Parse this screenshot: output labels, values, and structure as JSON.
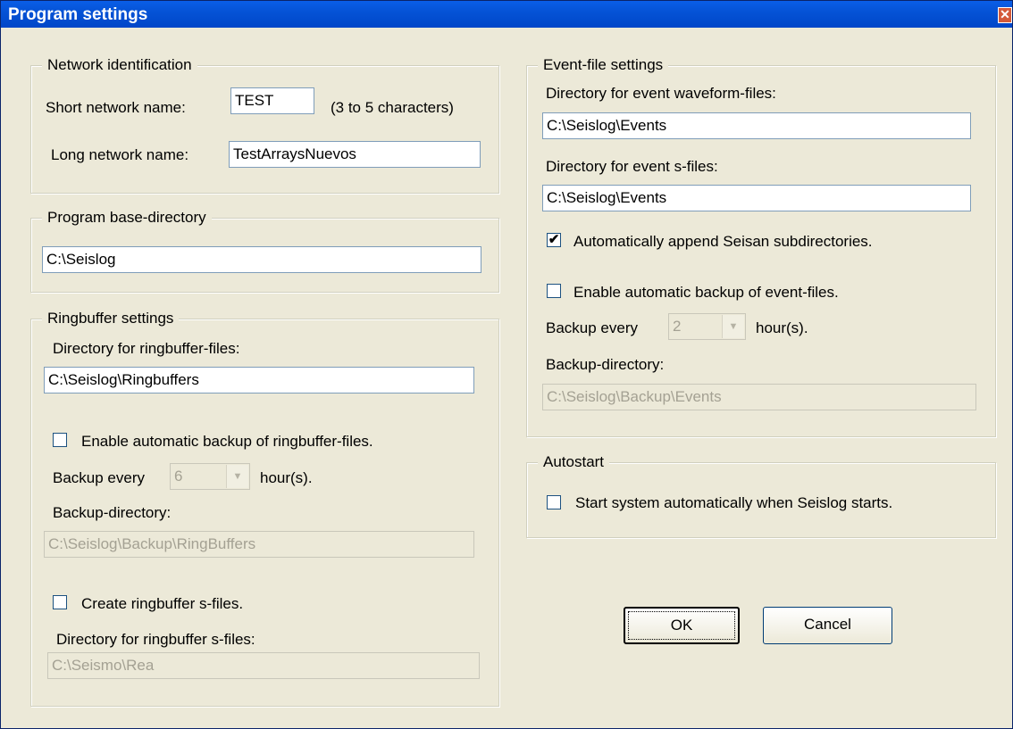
{
  "window": {
    "title": "Program settings"
  },
  "network": {
    "legend": "Network identification",
    "short_label": "Short network name:",
    "short_value": "TEST",
    "short_hint": "(3 to 5 characters)",
    "long_label": "Long network name:",
    "long_value": "TestArraysNuevos"
  },
  "base_dir": {
    "legend": "Program base-directory",
    "value": "C:\\Seislog"
  },
  "ringbuffer": {
    "legend": "Ringbuffer settings",
    "dir_label": "Directory for ringbuffer-files:",
    "dir_value": "C:\\Seislog\\Ringbuffers",
    "backup_enable_label": "Enable automatic backup of ringbuffer-files.",
    "backup_enable_checked": false,
    "backup_every_label": "Backup every",
    "backup_every_value": "6",
    "backup_every_unit": "hour(s).",
    "backup_dir_label": "Backup-directory:",
    "backup_dir_value": "C:\\Seislog\\Backup\\RingBuffers",
    "sfiles_label": "Create ringbuffer s-files.",
    "sfiles_checked": false,
    "sfiles_dir_label": "Directory for ringbuffer s-files:",
    "sfiles_dir_value": "C:\\Seismo\\Rea"
  },
  "event": {
    "legend": "Event-file settings",
    "waveform_dir_label": "Directory for event waveform-files:",
    "waveform_dir_value": "C:\\Seislog\\Events",
    "sfile_dir_label": "Directory for event s-files:",
    "sfile_dir_value": "C:\\Seislog\\Events",
    "append_label": "Automatically append Seisan subdirectories.",
    "append_checked": true,
    "append_mark": "✔",
    "backup_enable_label": "Enable automatic backup of event-files.",
    "backup_enable_checked": false,
    "backup_every_label": "Backup every",
    "backup_every_value": "2",
    "backup_every_unit": "hour(s).",
    "backup_dir_label": "Backup-directory:",
    "backup_dir_value": "C:\\Seislog\\Backup\\Events"
  },
  "autostart": {
    "legend": "Autostart",
    "label": "Start system automatically when Seislog starts.",
    "checked": false
  },
  "buttons": {
    "ok": "OK",
    "cancel": "Cancel"
  },
  "icons": {
    "close": "close-icon",
    "dropdown": "chevron-down-icon",
    "check": "checkmark-icon"
  },
  "colors": {
    "titlebar": "#0553d6",
    "dialog_bg": "#ece9d8",
    "close": "#d45a3a"
  }
}
